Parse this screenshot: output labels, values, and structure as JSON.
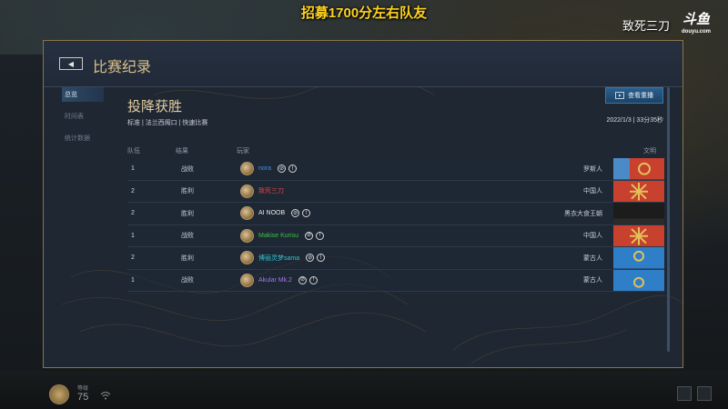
{
  "stream": {
    "banner": "招募1700分左右队友",
    "streamer": "致死三刀",
    "platform_logo": "斗鱼",
    "platform_sub": "douyu.com"
  },
  "modal": {
    "back_icon": "chevron-left-icon",
    "title": "比赛纪录",
    "nav": [
      {
        "label": "总览",
        "active": true
      },
      {
        "label": "时间表",
        "active": false
      },
      {
        "label": "统计数据",
        "active": false
      }
    ],
    "result_title": "投降获胜",
    "match_info": "标准 | 法兰西阁口 | 快速比赛",
    "replay_button": "查看重播",
    "date_time": "2022/1/3 | 33分35秒",
    "columns": {
      "team": "队伍",
      "result": "结果",
      "player": "玩家",
      "civ": "文明"
    },
    "rows": [
      {
        "team": "1",
        "result": "战败",
        "player": "nora",
        "name_color": "#4a8fe0",
        "civ": "罗斯人",
        "flag": "rus"
      },
      {
        "team": "2",
        "result": "胜利",
        "player": "致死三刀",
        "name_color": "#e04848",
        "civ": "中国人",
        "flag": "chinese"
      },
      {
        "team": "2",
        "result": "胜利",
        "player": "AI NOOB",
        "name_color": "#e8e8e8",
        "civ": "黑衣大食王朝",
        "flag": "abbasid"
      },
      {
        "team": "1",
        "result": "战败",
        "player": "Makise Kurisu",
        "name_color": "#3fc04a",
        "civ": "中国人",
        "flag": "chinese"
      },
      {
        "team": "2",
        "result": "胜利",
        "player": "博丽灵梦sama",
        "name_color": "#36c6d0",
        "civ": "蒙古人",
        "flag": "mongol"
      },
      {
        "team": "1",
        "result": "战败",
        "player": "Akular Mk.2",
        "name_color": "#a876e6",
        "civ": "蒙古人",
        "flag": "mongol"
      }
    ]
  },
  "hud": {
    "label": "等级",
    "value": "75"
  }
}
